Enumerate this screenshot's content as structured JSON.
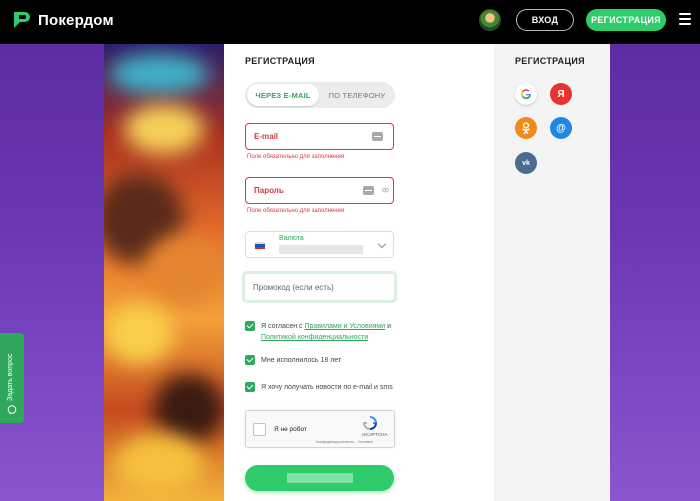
{
  "header": {
    "brand": "Покердом",
    "login_label": "ВХОД",
    "register_label": "РЕГИСТРАЦИЯ"
  },
  "form": {
    "title": "РЕГИСТРАЦИЯ",
    "tabs": [
      {
        "label": "ЧЕРЕЗ E-MAIL",
        "active": true
      },
      {
        "label": "ПО ТЕЛЕФОНУ",
        "active": false
      }
    ],
    "email": {
      "label": "E-mail",
      "error": "Поле обязательно для заполнения"
    },
    "password": {
      "label": "Пароль",
      "error": "Поле обязательно для заполнения"
    },
    "currency": {
      "label": "Валюта"
    },
    "promo": {
      "placeholder": "Промокод (если есть)"
    },
    "terms": {
      "prefix": "Я согласен с ",
      "link1": "Правилами и Условиями",
      "middle": " и ",
      "link2": "Политикой конфиденциальности"
    },
    "age_check": "Мне исполнилось 18 лет",
    "news_check": "Я хочу получать новости по e-mail и sms",
    "recaptcha": {
      "label": "Я не робот",
      "brand": "reCAPTCHA",
      "privacy": "Конфиденциальность - Условия"
    }
  },
  "social": {
    "title": "РЕГИСТРАЦИЯ",
    "buttons": [
      {
        "name": "google",
        "glyph": "G",
        "color": "#ffffff"
      },
      {
        "name": "yandex",
        "glyph": "Я",
        "color": "#e7322f"
      },
      {
        "name": "odnoklassniki",
        "glyph": "ok",
        "color": "#f08a1d"
      },
      {
        "name": "mail",
        "glyph": "@",
        "color": "#1e88e5"
      },
      {
        "name": "vkontakte",
        "glyph": "vk",
        "color": "#4c6b8f"
      }
    ]
  },
  "side_tab": {
    "label": "Задать вопрос"
  },
  "colors": {
    "accent_green": "#2fcc6b",
    "error_red": "#d6394a",
    "header_bg": "#000000"
  }
}
